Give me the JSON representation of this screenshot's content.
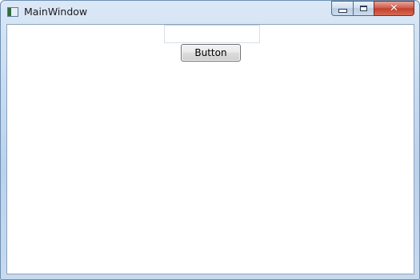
{
  "window": {
    "title": "MainWindow",
    "icon": "window-app-icon",
    "caption_buttons": {
      "minimize_icon": "minimize-icon",
      "maximize_icon": "maximize-icon",
      "close_icon": "close-icon",
      "close_glyph": "✕"
    }
  },
  "content": {
    "textbox": {
      "value": "",
      "placeholder": ""
    },
    "button_label": "Button"
  },
  "colors": {
    "close_button": "#c2402c",
    "titlebar": "#c9dcf0"
  }
}
